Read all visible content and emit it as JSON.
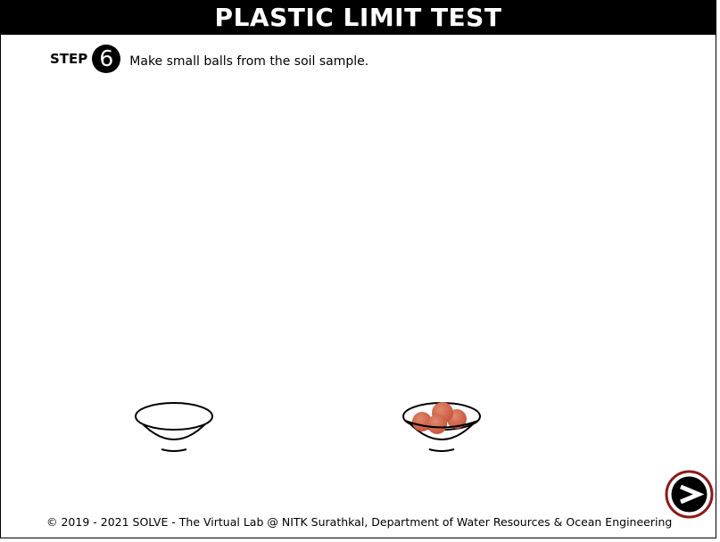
{
  "header": {
    "title": "PLASTIC LIMIT TEST"
  },
  "step": {
    "label": "STEP",
    "number": "6",
    "instruction": "Make small balls from the soil sample."
  },
  "colors": {
    "soil_ball": "#c8553d",
    "soil_ball_highlight": "#e08a6e",
    "next_button_ring": "#8b1a1a"
  },
  "icons": {
    "empty_bowl": "empty-bowl-icon",
    "soil_balls_bowl": "bowl-with-soil-balls-icon",
    "next": "next-arrow-icon"
  },
  "footer": {
    "copyright": "© 2019 - 2021 SOLVE - The Virtual Lab @ NITK Surathkal, Department of Water Resources & Ocean Engineering"
  }
}
